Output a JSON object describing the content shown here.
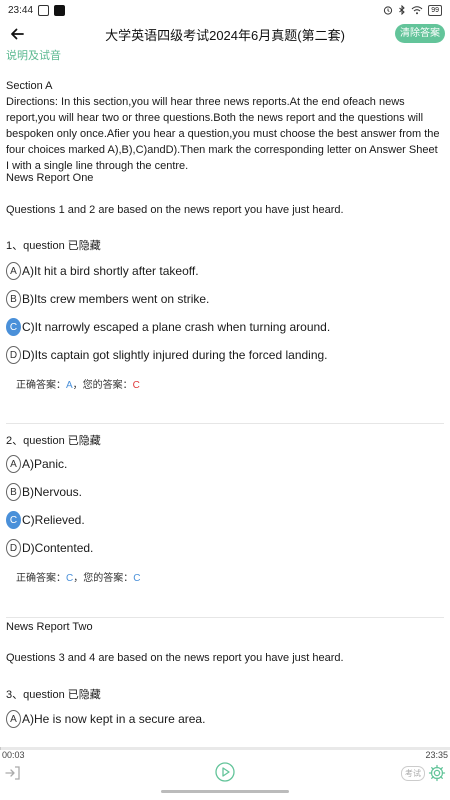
{
  "status_bar": {
    "time": "23:44",
    "battery": "99"
  },
  "header": {
    "title": "大学英语四级考试2024年6月真题(第二套)",
    "clear_label": "清除答案"
  },
  "intro_link": "说明及试音",
  "section": {
    "heading": "Section A",
    "directions": "Directions: In this section,you will hear three news reports.At the end ofeach news report,you will hear two or three questions.Both the news report and the questions will bespoken only once.Afier you hear a question,you must choose the best answer from the four choices marked A),B),C)andD).Then mark the corresponding letter on Answer Sheet I with a single line through the centre."
  },
  "report1": {
    "title": "News Report One",
    "intro": "Questions 1 and 2 are based on the news report you have just heard."
  },
  "q1": {
    "title": "1、question 已隐藏",
    "options": [
      {
        "letter": "A",
        "text": "A)It hit a bird shortly after takeoff."
      },
      {
        "letter": "B",
        "text": "B)Its crew members went on strike."
      },
      {
        "letter": "C",
        "text": "C)It narrowly escaped a plane crash when turning around."
      },
      {
        "letter": "D",
        "text": "D)Its captain got slightly injured during the forced landing."
      }
    ],
    "answer_label": "正确答案：",
    "correct": "A",
    "your_label": "，您的答案：",
    "yours": "C"
  },
  "q2": {
    "title": "2、question 已隐藏",
    "options": [
      {
        "letter": "A",
        "text": "A)Panic."
      },
      {
        "letter": "B",
        "text": "B)Nervous."
      },
      {
        "letter": "C",
        "text": "C)Relieved."
      },
      {
        "letter": "D",
        "text": "D)Contented."
      }
    ],
    "answer_label": "正确答案：",
    "correct": "C",
    "your_label": "，您的答案：",
    "yours": "C"
  },
  "report2": {
    "title": "News Report Two",
    "intro": "Questions 3 and 4 are based on the news report you have just heard."
  },
  "q3": {
    "title": "3、question 已隐藏",
    "options": [
      {
        "letter": "A",
        "text": "A)He is now kept in a secure area."
      }
    ]
  },
  "player": {
    "current_time": "00:03",
    "total_time": "23:35",
    "progress": 0.002,
    "exam_label": "考试"
  },
  "colors": {
    "accent": "#63c49a",
    "selected": "#4a90d9",
    "wrong": "#e03b3b"
  }
}
